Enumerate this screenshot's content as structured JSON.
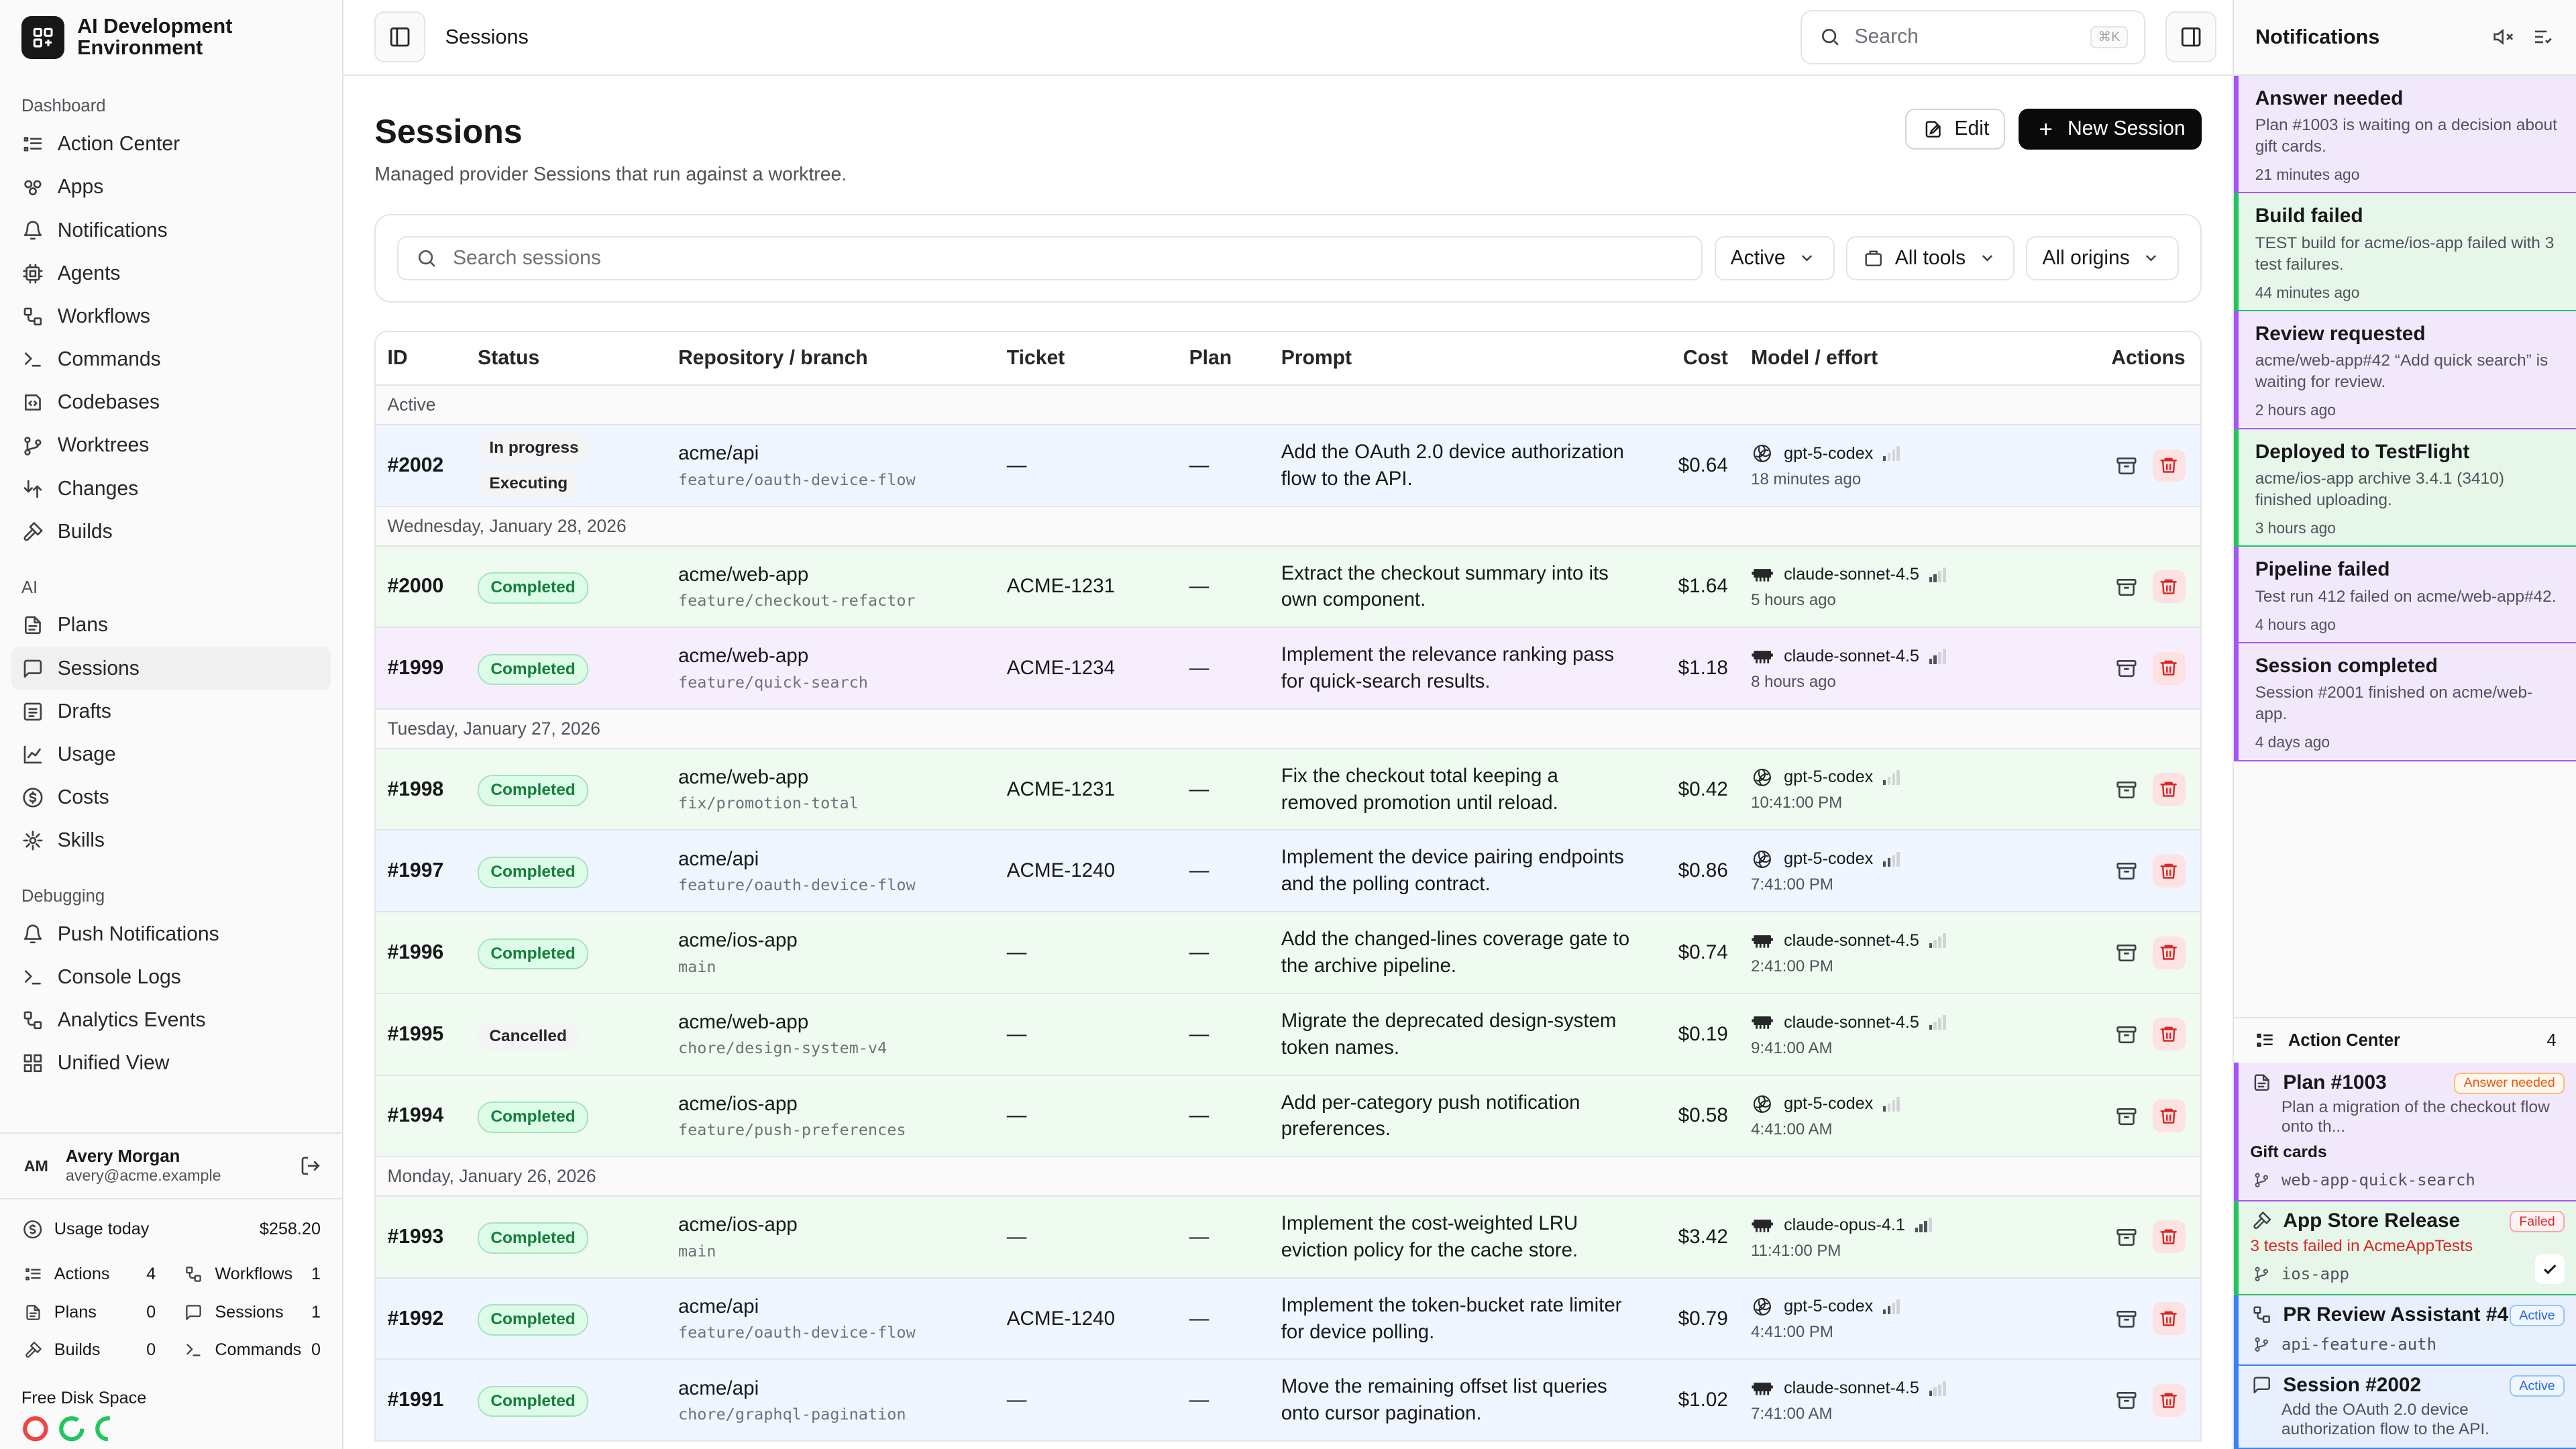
{
  "brand": {
    "name_line1": "AI Development",
    "name_line2": "Environment"
  },
  "sidebar": {
    "dashboard_label": "Dashboard",
    "dashboard": [
      "Action Center",
      "Apps",
      "Notifications",
      "Agents",
      "Workflows",
      "Commands",
      "Codebases",
      "Worktrees",
      "Changes",
      "Builds"
    ],
    "ai_label": "AI",
    "ai": [
      "Plans",
      "Sessions",
      "Drafts",
      "Usage",
      "Costs",
      "Skills"
    ],
    "debug_label": "Debugging",
    "debug": [
      "Push Notifications",
      "Console Logs",
      "Analytics Events",
      "Unified View"
    ]
  },
  "user": {
    "initials": "AM",
    "name": "Avery Morgan",
    "email": "avery@acme.example"
  },
  "usage": {
    "label": "Usage today",
    "value": "$258.20",
    "stats": [
      {
        "label": "Actions",
        "n": "4"
      },
      {
        "label": "Workflows",
        "n": "1"
      },
      {
        "label": "Plans",
        "n": "0"
      },
      {
        "label": "Sessions",
        "n": "1"
      },
      {
        "label": "Builds",
        "n": "0"
      },
      {
        "label": "Commands",
        "n": "0"
      }
    ],
    "disk_label": "Free Disk Space"
  },
  "topbar": {
    "crumb": "Sessions",
    "search": "Search",
    "kbd": "⌘K"
  },
  "page": {
    "title": "Sessions",
    "subtitle": "Managed provider Sessions that run against a worktree.",
    "edit": "Edit",
    "new": "New Session"
  },
  "filters": {
    "placeholder": "Search sessions",
    "status": "Active",
    "tools": "All tools",
    "origins": "All origins"
  },
  "table": {
    "headers": {
      "id": "ID",
      "status": "Status",
      "repo": "Repository / branch",
      "ticket": "Ticket",
      "plan": "Plan",
      "prompt": "Prompt",
      "cost": "Cost",
      "model": "Model / effort",
      "actions": "Actions"
    },
    "groups": [
      {
        "label": "Active",
        "rows": [
          {
            "id": "#2002",
            "status": [
              "In progress",
              "Executing"
            ],
            "repo": "acme/api",
            "branch": "feature/oauth-device-flow",
            "ticket": "—",
            "plan": "—",
            "prompt": "Add the OAuth 2.0 device authorization flow to the API.",
            "cost": "$0.64",
            "model": "gpt-5-codex",
            "vendor": "openai",
            "effort": 1,
            "time": "18 minutes ago",
            "tone": "blue"
          }
        ]
      },
      {
        "label": "Wednesday, January 28, 2026",
        "rows": [
          {
            "id": "#2000",
            "status": [
              "Completed"
            ],
            "repo": "acme/web-app",
            "branch": "feature/checkout-refactor",
            "ticket": "ACME-1231",
            "plan": "—",
            "prompt": "Extract the checkout summary into its own component.",
            "cost": "$1.64",
            "model": "claude-sonnet-4.5",
            "vendor": "claude",
            "effort": 2,
            "time": "5 hours ago",
            "tone": "green"
          },
          {
            "id": "#1999",
            "status": [
              "Completed"
            ],
            "repo": "acme/web-app",
            "branch": "feature/quick-search",
            "ticket": "ACME-1234",
            "plan": "—",
            "prompt": "Implement the relevance ranking pass for quick-search results.",
            "cost": "$1.18",
            "model": "claude-sonnet-4.5",
            "vendor": "claude",
            "effort": 2,
            "time": "8 hours ago",
            "tone": "purple"
          }
        ]
      },
      {
        "label": "Tuesday, January 27, 2026",
        "rows": [
          {
            "id": "#1998",
            "status": [
              "Completed"
            ],
            "repo": "acme/web-app",
            "branch": "fix/promotion-total",
            "ticket": "ACME-1231",
            "plan": "—",
            "prompt": "Fix the checkout total keeping a removed promotion until reload.",
            "cost": "$0.42",
            "model": "gpt-5-codex",
            "vendor": "openai",
            "effort": 1,
            "time": "10:41:00 PM",
            "tone": "green"
          },
          {
            "id": "#1997",
            "status": [
              "Completed"
            ],
            "repo": "acme/api",
            "branch": "feature/oauth-device-flow",
            "ticket": "ACME-1240",
            "plan": "—",
            "prompt": "Implement the device pairing endpoints and the polling contract.",
            "cost": "$0.86",
            "model": "gpt-5-codex",
            "vendor": "openai",
            "effort": 2,
            "time": "7:41:00 PM",
            "tone": "blue"
          },
          {
            "id": "#1996",
            "status": [
              "Completed"
            ],
            "repo": "acme/ios-app",
            "branch": "main",
            "ticket": "—",
            "plan": "—",
            "prompt": "Add the changed-lines coverage gate to the archive pipeline.",
            "cost": "$0.74",
            "model": "claude-sonnet-4.5",
            "vendor": "claude",
            "effort": 1,
            "time": "2:41:00 PM",
            "tone": "green"
          },
          {
            "id": "#1995",
            "status": [
              "Cancelled"
            ],
            "repo": "acme/web-app",
            "branch": "chore/design-system-v4",
            "ticket": "—",
            "plan": "—",
            "prompt": "Migrate the deprecated design-system token names.",
            "cost": "$0.19",
            "model": "claude-sonnet-4.5",
            "vendor": "claude",
            "effort": 1,
            "time": "9:41:00 AM",
            "tone": "green"
          },
          {
            "id": "#1994",
            "status": [
              "Completed"
            ],
            "repo": "acme/ios-app",
            "branch": "feature/push-preferences",
            "ticket": "—",
            "plan": "—",
            "prompt": "Add per-category push notification preferences.",
            "cost": "$0.58",
            "model": "gpt-5-codex",
            "vendor": "openai",
            "effort": 1,
            "time": "4:41:00 AM",
            "tone": "green"
          }
        ]
      },
      {
        "label": "Monday, January 26, 2026",
        "rows": [
          {
            "id": "#1993",
            "status": [
              "Completed"
            ],
            "repo": "acme/ios-app",
            "branch": "main",
            "ticket": "—",
            "plan": "—",
            "prompt": "Implement the cost-weighted LRU eviction policy for the cache store.",
            "cost": "$3.42",
            "model": "claude-opus-4.1",
            "vendor": "claude",
            "effort": 3,
            "time": "11:41:00 PM",
            "tone": "green"
          },
          {
            "id": "#1992",
            "status": [
              "Completed"
            ],
            "repo": "acme/api",
            "branch": "feature/oauth-device-flow",
            "ticket": "ACME-1240",
            "plan": "—",
            "prompt": "Implement the token-bucket rate limiter for device polling.",
            "cost": "$0.79",
            "model": "gpt-5-codex",
            "vendor": "openai",
            "effort": 2,
            "time": "4:41:00 PM",
            "tone": "blue"
          },
          {
            "id": "#1991",
            "status": [
              "Completed"
            ],
            "repo": "acme/api",
            "branch": "chore/graphql-pagination",
            "ticket": "—",
            "plan": "—",
            "prompt": "Move the remaining offset list queries onto cursor pagination.",
            "cost": "$1.02",
            "model": "claude-sonnet-4.5",
            "vendor": "claude",
            "effort": 1,
            "time": "7:41:00 AM",
            "tone": "blue"
          }
        ]
      }
    ]
  },
  "notifications": {
    "title": "Notifications",
    "items": [
      {
        "title": "Answer needed",
        "desc": "Plan #1003 is waiting on a decision about gift cards.",
        "when": "21 minutes ago",
        "tone": "purple"
      },
      {
        "title": "Build failed",
        "desc": "TEST build for acme/ios-app failed with 3 test failures.",
        "when": "44 minutes ago",
        "tone": "green"
      },
      {
        "title": "Review requested",
        "desc": "acme/web-app#42 “Add quick search” is waiting for review.",
        "when": "2 hours ago",
        "tone": "purple"
      },
      {
        "title": "Deployed to TestFlight",
        "desc": "acme/ios-app archive 3.4.1 (3410) finished uploading.",
        "when": "3 hours ago",
        "tone": "green"
      },
      {
        "title": "Pipeline failed",
        "desc": "Test run 412 failed on acme/web-app#42.",
        "when": "4 hours ago",
        "tone": "purple"
      },
      {
        "title": "Session completed",
        "desc": "Session #2001 finished on acme/web-app.",
        "when": "4 days ago",
        "tone": "purple"
      }
    ]
  },
  "action_center": {
    "title": "Action Center",
    "count": "4",
    "items": [
      {
        "title": "Plan #1003",
        "tag": "Answer needed",
        "desc": "Plan a migration of the checkout flow onto th...",
        "extra": "Gift cards",
        "branch": "web-app-quick-search"
      },
      {
        "title": "App Store Release",
        "tag": "Failed",
        "error": "3 tests failed in AcmeAppTests",
        "branch": "ios-app"
      },
      {
        "title": "PR Review Assistant #4...",
        "tag": "Active",
        "branch": "api-feature-auth"
      },
      {
        "title": "Session #2002",
        "tag": "Active",
        "desc": "Add the OAuth 2.0 device authorization flow to the API."
      }
    ]
  },
  "colors": {
    "accent": "#0a0a0a",
    "purple": "#a855f7",
    "green": "#22c55e",
    "blue": "#3b82f6",
    "danger": "#dc2626"
  }
}
